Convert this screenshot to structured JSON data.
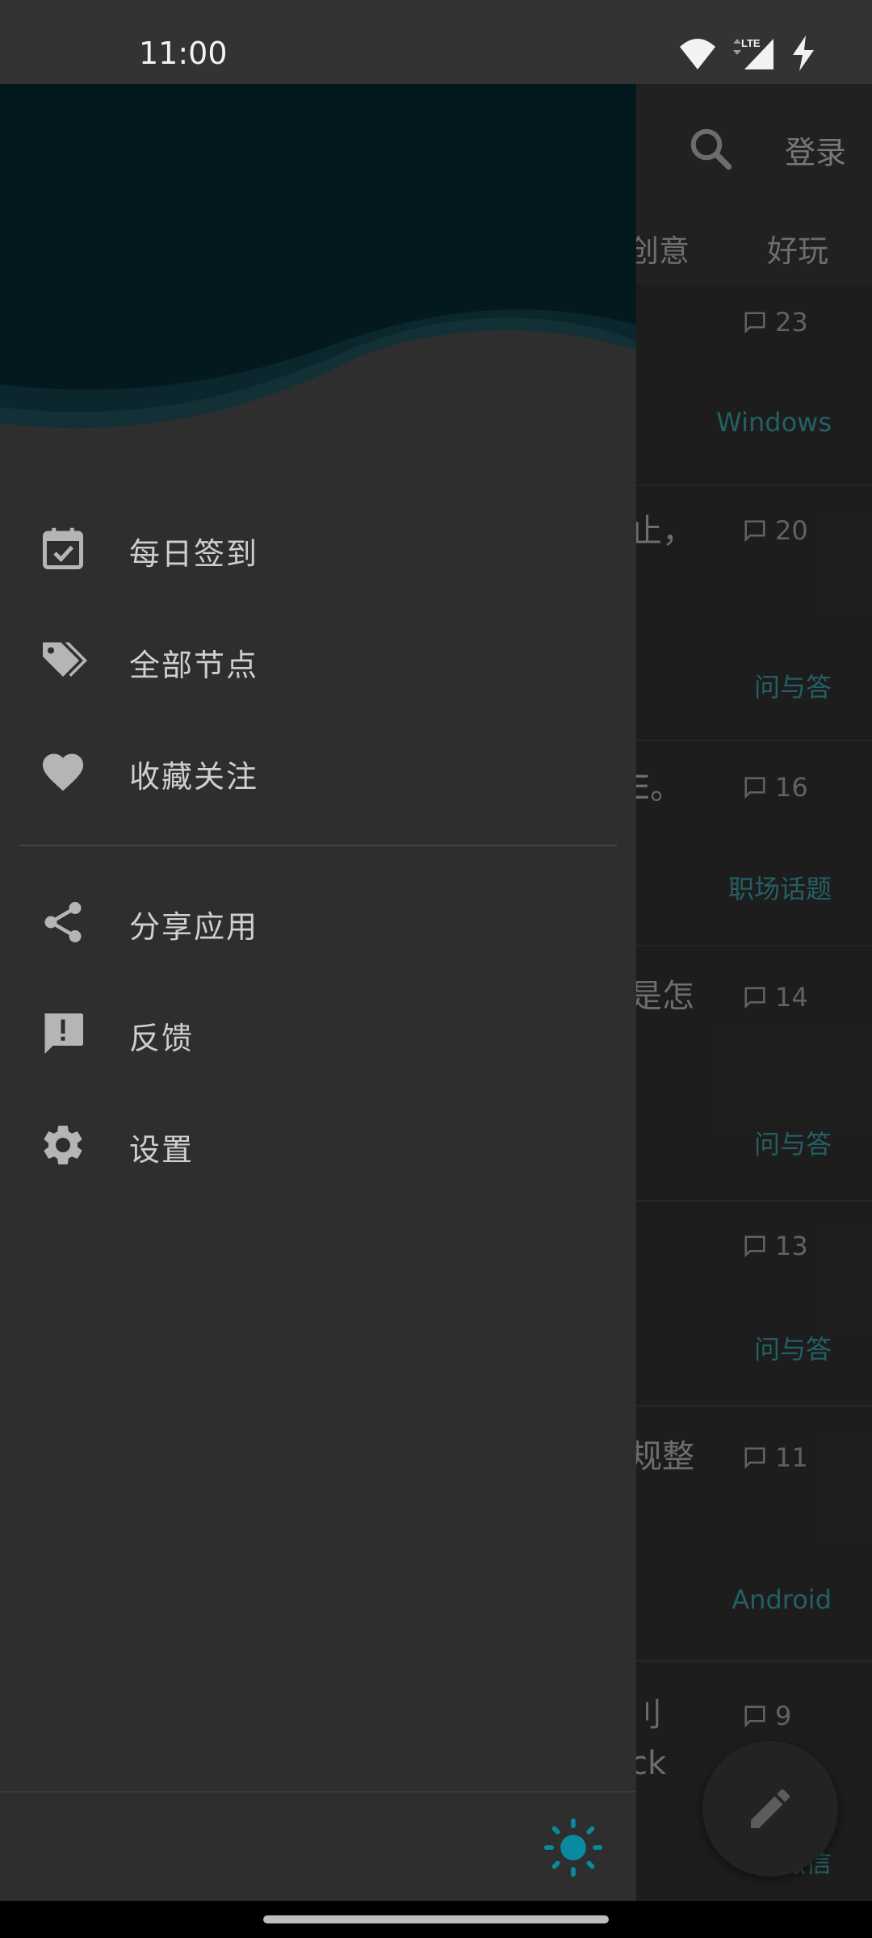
{
  "status_bar": {
    "time": "11:00",
    "network": "LTE"
  },
  "toolbar": {
    "login_label": "登录",
    "search_icon": "search-icon"
  },
  "tabs": [
    {
      "label": "创意"
    },
    {
      "label": "好玩"
    }
  ],
  "topics": [
    {
      "title": "",
      "replies": "23",
      "node": "Windows"
    },
    {
      "title": "止，",
      "replies": "20",
      "node": "问与答"
    },
    {
      "title": "E。",
      "replies": "16",
      "node": "职场话题"
    },
    {
      "title": "是怎",
      "replies": "14",
      "node": "问与答"
    },
    {
      "title": "",
      "replies": "13",
      "node": "问与答"
    },
    {
      "title": "规整",
      "replies": "11",
      "node": "Android"
    },
    {
      "title": "刂",
      "title2": "ck",
      "replies": "9",
      "node": "微信"
    }
  ],
  "drawer": {
    "items": [
      {
        "label": "每日签到",
        "icon": "calendar-check-icon"
      },
      {
        "label": "全部节点",
        "icon": "tags-icon"
      },
      {
        "label": "收藏关注",
        "icon": "heart-icon"
      },
      {
        "label": "分享应用",
        "icon": "share-icon"
      },
      {
        "label": "反馈",
        "icon": "feedback-icon"
      },
      {
        "label": "设置",
        "icon": "gear-icon"
      }
    ],
    "theme_toggle_icon": "sun-icon"
  },
  "colors": {
    "header_dark": "#03191e",
    "accent": "#0a8aa0",
    "drawer_bg": "#2e2e2e",
    "node_tag": "#2f7a80"
  }
}
